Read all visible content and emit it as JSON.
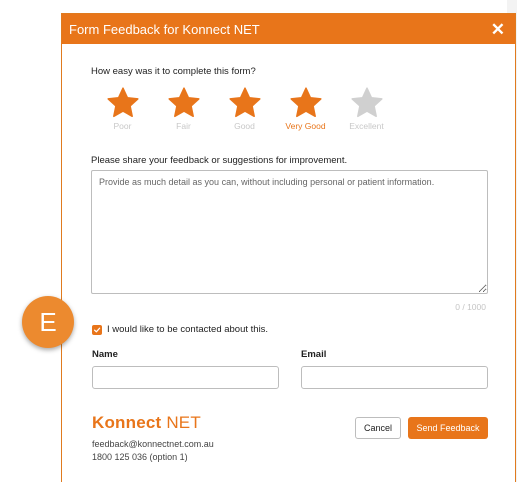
{
  "dialog": {
    "title": "Form Feedback for Konnect NET",
    "close_symbol": "✕"
  },
  "rating": {
    "question": "How easy was it to complete this form?",
    "selected_value": 4,
    "max": 5,
    "items": [
      {
        "label": "Poor",
        "filled": true,
        "active_label": false
      },
      {
        "label": "Fair",
        "filled": true,
        "active_label": false
      },
      {
        "label": "Good",
        "filled": true,
        "active_label": false
      },
      {
        "label": "Very Good",
        "filled": true,
        "active_label": true
      },
      {
        "label": "Excellent",
        "filled": false,
        "active_label": false
      }
    ],
    "filled_color": "#e8751a",
    "empty_color": "#d0d0d0"
  },
  "feedback": {
    "label": "Please share your feedback or suggestions for improvement.",
    "placeholder": "Provide as much detail as you can, without including personal or patient information.",
    "value": "",
    "counter": "0 / 1000"
  },
  "contact": {
    "checkbox_label": "I would like to be contacted about this.",
    "checked": true,
    "name_label": "Name",
    "name_value": "",
    "email_label": "Email",
    "email_value": ""
  },
  "brand": {
    "name_bold": "Konnect",
    "name_thin": " NET",
    "email": "feedback@konnectnet.com.au",
    "phone": "1800 125 036 (option 1)"
  },
  "buttons": {
    "cancel": "Cancel",
    "send": "Send Feedback"
  },
  "step_badge": "E",
  "colors": {
    "accent": "#e8751a",
    "badge": "#ec8a2f"
  }
}
